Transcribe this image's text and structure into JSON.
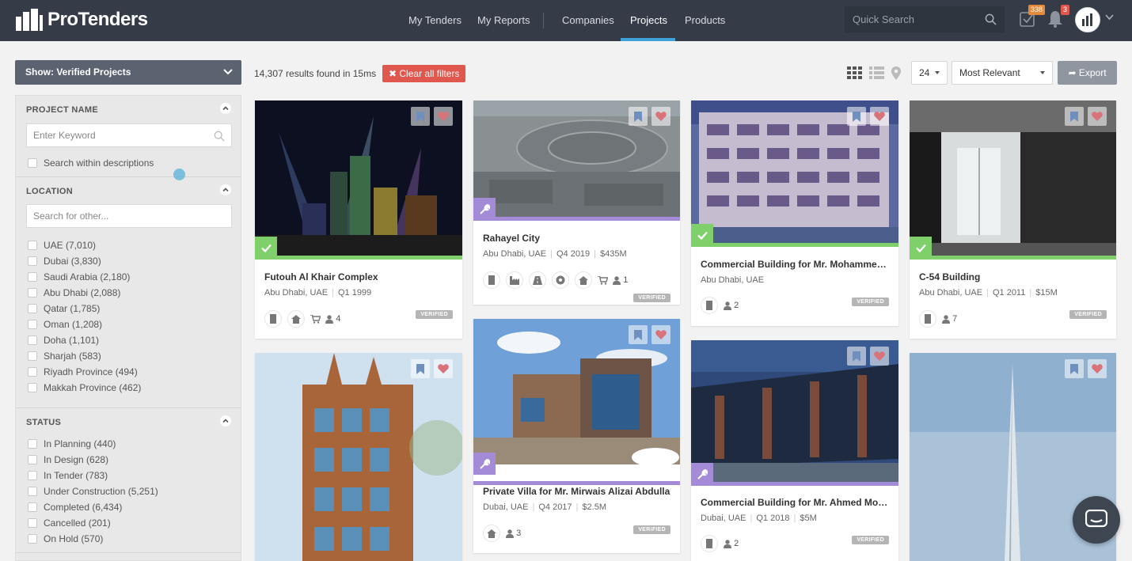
{
  "app": {
    "logo_text": "ProTenders"
  },
  "nav": {
    "items": [
      "My Tenders",
      "My Reports",
      "Companies",
      "Projects",
      "Products"
    ],
    "active": "Projects"
  },
  "search": {
    "placeholder": "Quick Search"
  },
  "badges": {
    "tasks": "338",
    "notifications": "3"
  },
  "filter_show": "Show: Verified Projects",
  "sidebar": {
    "project_name": {
      "heading": "PROJECT NAME",
      "placeholder": "Enter Keyword",
      "checkbox": "Search within descriptions"
    },
    "location": {
      "heading": "LOCATION",
      "placeholder": "Search for other...",
      "items": [
        "UAE (7,010)",
        "Dubai (3,830)",
        "Saudi Arabia (2,180)",
        "Abu Dhabi (2,088)",
        "Qatar (1,785)",
        "Oman (1,208)",
        "Doha (1,101)",
        "Sharjah (583)",
        "Riyadh Province (494)",
        "Makkah Province (462)"
      ]
    },
    "status": {
      "heading": "STATUS",
      "items": [
        "In Planning (440)",
        "In Design (628)",
        "In Tender (783)",
        "Under Construction (5,251)",
        "Completed (6,434)",
        "Cancelled (201)",
        "On Hold (570)"
      ]
    }
  },
  "toolbar": {
    "results": "14,307 results found in 15ms",
    "clear": "Clear all filters",
    "per_page": "24",
    "sort": "Most Relevant",
    "export": "Export"
  },
  "cards": [
    {
      "title": "Futouh Al Khair Complex",
      "location": "Abu Dhabi, UAE",
      "date": "Q1 1999",
      "value": "",
      "count": "4",
      "badge": "VERIFIED",
      "stage": "completed"
    },
    {
      "title": "Rahayel City",
      "location": "Abu Dhabi, UAE",
      "date": "Q4 2019",
      "value": "$435M",
      "count": "1",
      "badge": "VERIFIED",
      "stage": "construction"
    },
    {
      "title": "Commercial Building for Mr. Mohammed Al Hameli",
      "location": "Abu Dhabi, UAE",
      "date": "",
      "value": "",
      "count": "2",
      "badge": "VERIFIED",
      "stage": "completed"
    },
    {
      "title": "C-54 Building",
      "location": "Abu Dhabi, UAE",
      "date": "Q1 2011",
      "value": "$15M",
      "count": "7",
      "badge": "VERIFIED",
      "stage": "completed"
    },
    {
      "title": "Private Villa for Mr. Mirwais Alizai Abdulla",
      "location": "Dubai, UAE",
      "date": "Q4 2017",
      "value": "$2.5M",
      "count": "3",
      "badge": "VERIFIED",
      "stage": "construction"
    },
    {
      "title": "Commercial Building for Mr. Ahmed Mohammed",
      "location": "Dubai, UAE",
      "date": "Q1 2018",
      "value": "$5M",
      "count": "2",
      "badge": "VERIFIED",
      "stage": "construction"
    }
  ],
  "colors": {
    "topbar": "#353c47",
    "accent": "#3fa1d8",
    "verified_green": "#7fcf6a",
    "construction_purple": "#a48bd8",
    "clear_red": "#e0574d"
  }
}
